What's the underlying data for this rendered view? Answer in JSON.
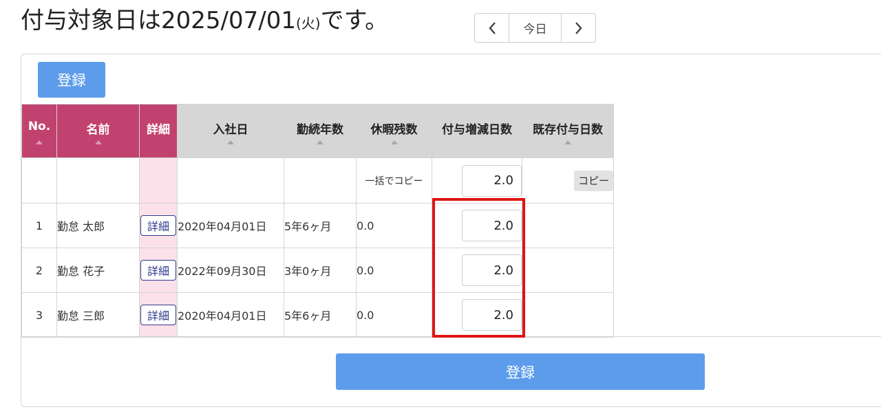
{
  "header": {
    "title_prefix": "付与対象日は",
    "date": "2025/07/01",
    "weekday": "(火)",
    "title_suffix": "です。"
  },
  "nav": {
    "today_label": "今日"
  },
  "toolbar": {
    "register_label": "登録"
  },
  "table": {
    "columns": [
      "No.",
      "名前",
      "詳細",
      "入社日",
      "勤続年数",
      "休暇残数",
      "付与増減日数",
      "既存付与日数"
    ],
    "bulk_row": {
      "label": "一括でコピー",
      "value": "2.0",
      "copy_label": "コピー"
    },
    "rows": [
      {
        "no": "1",
        "name": "勤怠 太郎",
        "detail": "詳細",
        "hire_date": "2020年04月01日",
        "tenure": "5年6ヶ月",
        "remaining": "0.0",
        "grant": "2.0"
      },
      {
        "no": "2",
        "name": "勤怠 花子",
        "detail": "詳細",
        "hire_date": "2022年09月30日",
        "tenure": "3年0ヶ月",
        "remaining": "0.0",
        "grant": "2.0"
      },
      {
        "no": "3",
        "name": "勤怠 三郎",
        "detail": "詳細",
        "hire_date": "2020年04月01日",
        "tenure": "5年6ヶ月",
        "remaining": "0.0",
        "grant": "2.0"
      }
    ]
  },
  "footer": {
    "register_label": "登録"
  },
  "colors": {
    "accent": "#5d9ceb",
    "header_pink": "#c2426f",
    "highlight": "#e01515"
  }
}
